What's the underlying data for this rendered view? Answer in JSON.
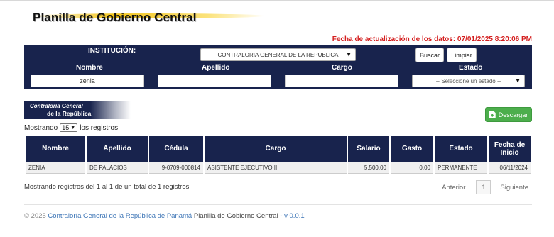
{
  "header": {
    "title": "Planilla de Gobierno Central",
    "update_stamp": "Fecha de actualización de los datos: 07/01/2025 8:20:06 PM"
  },
  "filters": {
    "institucion_label": "INSTITUCIÓN:",
    "institucion_value": "CONTRALORIA GENERAL DE LA REPUBLICA",
    "buscar_label": "Buscar",
    "limpiar_label": "Limpiar",
    "nombre_label": "Nombre",
    "apellido_label": "Apellido",
    "cargo_label": "Cargo",
    "estado_label": "Estado",
    "nombre_value": "zenia",
    "apellido_value": "",
    "cargo_value": "",
    "estado_value": "-- Seleccione un estado --"
  },
  "logo": {
    "line1": "Contraloría General",
    "line2": "de la República"
  },
  "download_label": "Descargar",
  "length_menu": {
    "prefix": "Mostrando",
    "value": "15",
    "suffix": "los registros"
  },
  "table": {
    "headers": [
      "Nombre",
      "Apellido",
      "Cédula",
      "Cargo",
      "Salario",
      "Gasto",
      "Estado",
      "Fecha de Inicio"
    ],
    "rows": [
      [
        "ZENIA",
        "DE PALACIOS",
        "9-0709-000814",
        "ASISTENTE EJECUTIVO II",
        "5,500.00",
        "0.00",
        "PERMANENTE",
        "06/11/2024"
      ]
    ]
  },
  "info": "Mostrando registros del 1 al 1 de un total de 1 registros",
  "pagination": {
    "prev": "Anterior",
    "current": "1",
    "next": "Siguiente"
  },
  "footer": {
    "copyright": "© 2025",
    "org_link": "Contraloría General de la República de Panamá",
    "app_name": "Planilla de Gobierno Central",
    "version": "- v 0.0.1"
  },
  "colors": {
    "navy": "#18234d",
    "alert_red": "#d41f1f",
    "success_green": "#4cae4c",
    "gold": "#f3c51a"
  }
}
